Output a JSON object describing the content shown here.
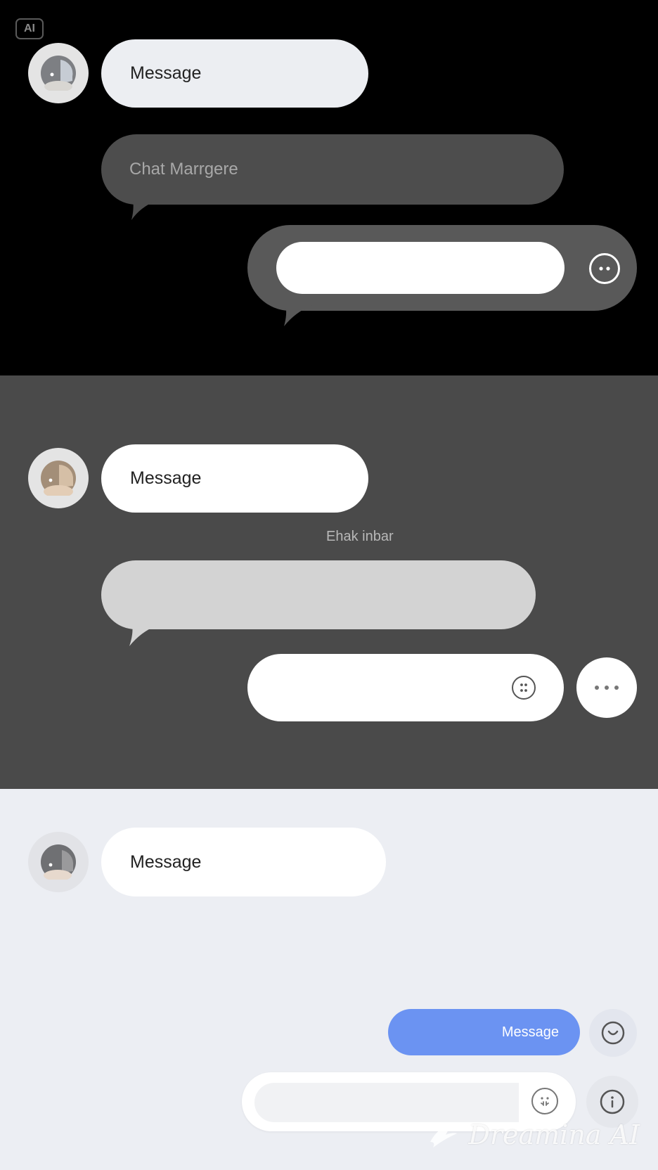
{
  "badge": {
    "label": "AI"
  },
  "panel_dark": {
    "message_label": "Message",
    "chat_bubble_text": "Chat Marrgere",
    "input_value": ""
  },
  "panel_gray": {
    "message_label": "Message",
    "caption": "Ehak inbar",
    "input_value": ""
  },
  "panel_light": {
    "message_label": "Message",
    "sent_message": "Message",
    "input_value": ""
  },
  "watermark": {
    "text": "Dreamina AI"
  },
  "colors": {
    "dark_bg": "#000000",
    "gray_bg": "#4a4a4a",
    "light_bg": "#eceef3",
    "accent_blue": "#6b93f2"
  }
}
